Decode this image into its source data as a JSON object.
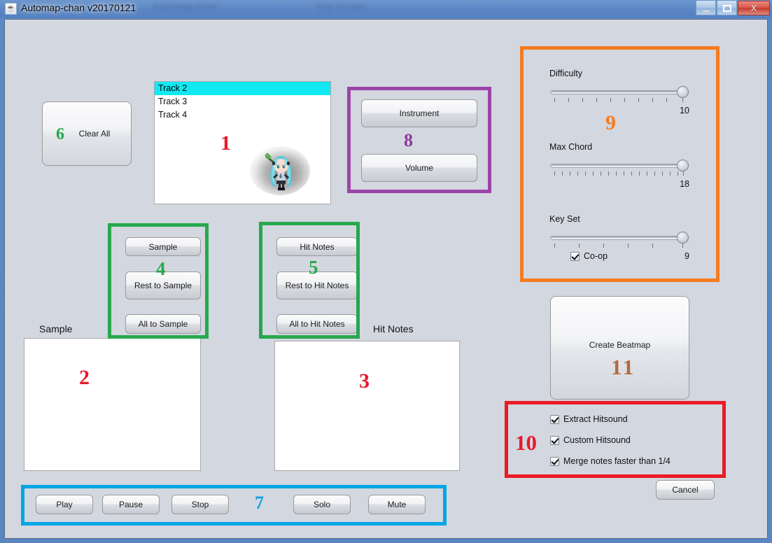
{
  "window": {
    "title": "Automap-chan v20170121",
    "app_icon": "java-coffee-icon",
    "ghost_title_left": "Automap-chan",
    "ghost_title_right": "File Screen",
    "buttons": {
      "minimize": "minimize-icon",
      "maximize": "maximize-icon",
      "close": "X"
    }
  },
  "track_list": {
    "items": [
      {
        "label": "Track 2",
        "selected": true
      },
      {
        "label": "Track 3",
        "selected": false
      },
      {
        "label": "Track 4",
        "selected": false
      }
    ],
    "sprite": "hatsune-miku-chibi-sprite"
  },
  "clear_all": {
    "label": "Clear All"
  },
  "instrument_panel": {
    "instrument_label": "Instrument",
    "volume_label": "Volume"
  },
  "sample_group": {
    "buttons": [
      "Sample",
      "Rest to Sample",
      "All to Sample"
    ]
  },
  "hitnotes_group": {
    "buttons": [
      "Hit Notes",
      "Rest to Hit Notes",
      "All to Hit Notes"
    ]
  },
  "sample_area": {
    "title": "Sample"
  },
  "hitnotes_area": {
    "title": "Hit Notes"
  },
  "transport": {
    "buttons": [
      "Play",
      "Pause",
      "Stop",
      "Solo",
      "Mute"
    ]
  },
  "settings": {
    "sliders": [
      {
        "label": "Difficulty",
        "value": "10",
        "min": 1,
        "max": 10,
        "ticks": 10,
        "fill": 1.0
      },
      {
        "label": "Max Chord",
        "value": "18",
        "min": 1,
        "max": 18,
        "ticks": 18,
        "fill": 1.0
      },
      {
        "label": "Key Set",
        "value": "9",
        "min": 1,
        "max": 9,
        "ticks": 6,
        "fill": 1.0
      }
    ],
    "coop": {
      "label": "Co-op",
      "checked": true
    }
  },
  "create_beatmap": {
    "label": "Create Beatmap"
  },
  "hitsound_options": {
    "items": [
      {
        "label": "Extract Hitsound",
        "checked": true
      },
      {
        "label": "Custom Hitsound",
        "checked": true
      },
      {
        "label": "Merge notes faster than 1/4",
        "checked": true
      }
    ]
  },
  "cancel": {
    "label": "Cancel"
  },
  "annotations": [
    {
      "id": "1",
      "color": "#e8192c",
      "box": null
    },
    {
      "id": "2",
      "color": "#e8192c",
      "box": null
    },
    {
      "id": "3",
      "color": "#e8192c",
      "box": null
    },
    {
      "id": "4",
      "color": "#27a84d",
      "box": "#27a84d"
    },
    {
      "id": "5",
      "color": "#27a84d",
      "box": "#27a84d"
    },
    {
      "id": "6",
      "color": "#27a84d",
      "box": null
    },
    {
      "id": "7",
      "color": "#14a3e0",
      "box": "#00a6e6"
    },
    {
      "id": "8",
      "color": "#8e3a99",
      "box": "#9b45a8"
    },
    {
      "id": "9",
      "color": "#f57c20",
      "box": "#f57c20"
    },
    {
      "id": "10",
      "color": "#e8192c",
      "box": "#ea1b24"
    },
    {
      "id": "11",
      "color": "#b5693c",
      "box": null
    }
  ],
  "colors": {
    "panel_bg": "#d3d7df",
    "selection": "#12e8f2",
    "annotation_red": "#e8192c",
    "annotation_green": "#27a84d",
    "annotation_blue": "#00a6e6",
    "annotation_purple": "#9b45a8",
    "annotation_orange": "#f57c20",
    "annotation_brown": "#b5693c"
  }
}
